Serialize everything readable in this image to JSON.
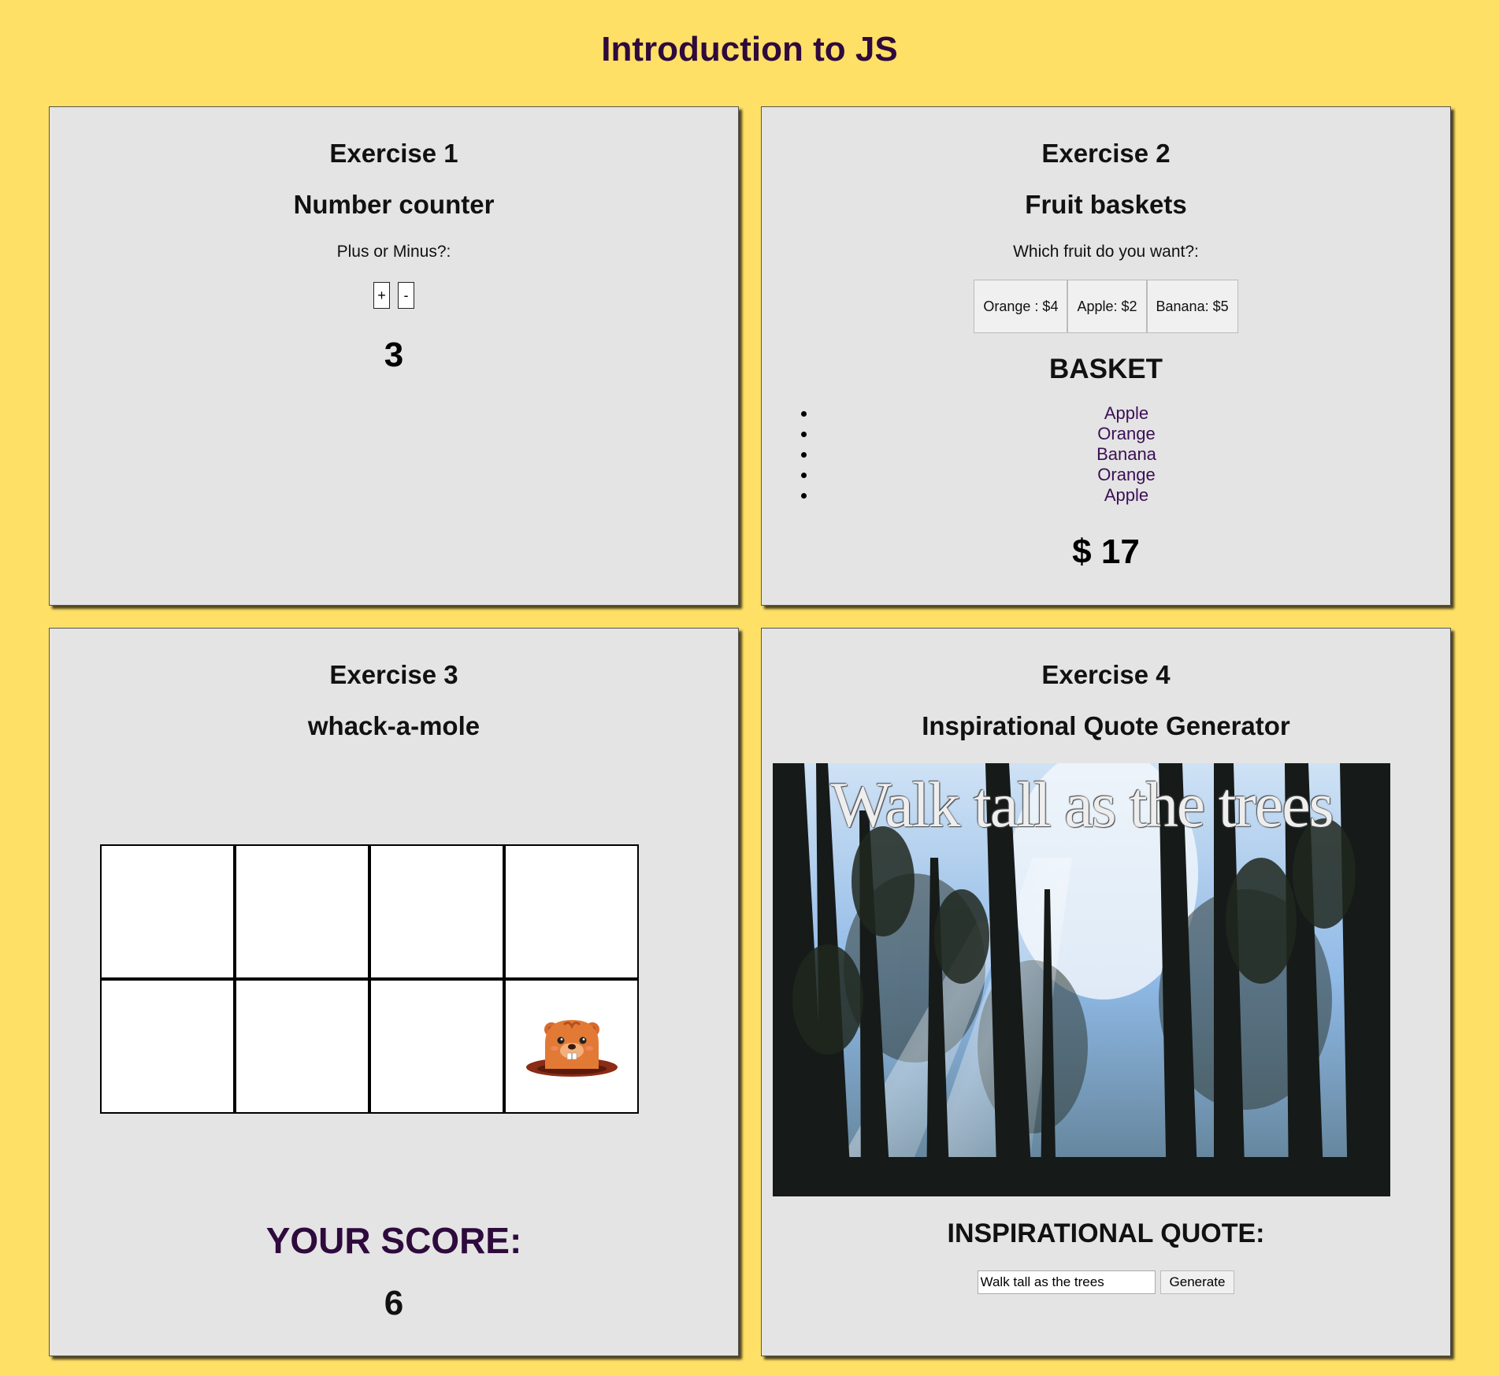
{
  "page": {
    "title": "Introduction to JS"
  },
  "exercise1": {
    "title": "Exercise 1",
    "subtitle": "Number counter",
    "prompt": "Plus or Minus?:",
    "plus_label": "+",
    "minus_label": "-",
    "count": "3"
  },
  "exercise2": {
    "title": "Exercise 2",
    "subtitle": "Fruit baskets",
    "prompt": "Which fruit do you want?:",
    "buttons": [
      "Orange : $4",
      "Apple: $2",
      "Banana: $5"
    ],
    "basket_title": "BASKET",
    "basket_items": [
      "Apple",
      "Orange",
      "Banana",
      "Orange",
      "Apple"
    ],
    "total": "$ 17"
  },
  "exercise3": {
    "title": "Exercise 3",
    "subtitle": "whack-a-mole",
    "holes": 8,
    "mole_hole_index": 7,
    "score_label": "YOUR SCORE:",
    "score": "6"
  },
  "exercise4": {
    "title": "Exercise 4",
    "subtitle": "Inspirational Quote Generator",
    "image_quote": "Walk tall as the trees",
    "quote_heading": "INSPIRATIONAL QUOTE:",
    "input_value": "Walk tall as the trees",
    "generate_label": "Generate"
  },
  "colors": {
    "background": "#FFE066",
    "card": "#e4e4e4",
    "heading_purple": "#2e0a3d",
    "list_text": "#3b1055"
  }
}
